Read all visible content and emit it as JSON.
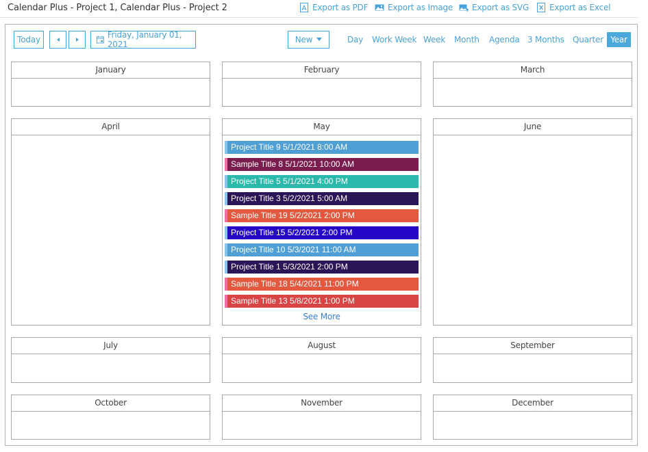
{
  "app": {
    "title": "Calendar Plus - Project 1, Calendar Plus - Project 2"
  },
  "exports": [
    {
      "label": "Export as PDF",
      "icon": "pdf-icon"
    },
    {
      "label": "Export as Image",
      "icon": "image-icon"
    },
    {
      "label": "Export as SVG",
      "icon": "svg-image-icon"
    },
    {
      "label": "Export as Excel",
      "icon": "excel-icon"
    }
  ],
  "toolbar": {
    "today_label": "Today",
    "prev_icon": "prev-icon",
    "next_icon": "next-icon",
    "date_label": "Friday, January 01, 2021",
    "new_label": "New",
    "views": [
      "Day",
      "Work Week",
      "Week",
      "Month",
      "Agenda",
      "3 Months",
      "Quarter",
      "Year"
    ],
    "active_view": "Year"
  },
  "colors": {
    "accent": "#4aa3d8",
    "active_tab_bg": "#4aa8dc",
    "border": "#a8a8a8",
    "see_more": "#3a7fd5",
    "project_accent": "#8cc3ea",
    "sample_accent": "#ee6fa6"
  },
  "months": [
    {
      "name": "January",
      "events": []
    },
    {
      "name": "February",
      "events": []
    },
    {
      "name": "March",
      "events": []
    },
    {
      "name": "April",
      "events": []
    },
    {
      "name": "May",
      "see_more": "See More",
      "events": [
        {
          "label": "Project Title 9 5/1/2021 8:00 AM",
          "color": "#4f9ed4",
          "accent": "#8cc3ea"
        },
        {
          "label": "Sample Title 8 5/1/2021 10:00 AM",
          "color": "#7b1c4e",
          "accent": "#ee6fa6"
        },
        {
          "label": "Project Title 5 5/1/2021 4:00 PM",
          "color": "#2bb9ab",
          "accent": "#8cc3ea"
        },
        {
          "label": "Project Title 3 5/2/2021 5:00 AM",
          "color": "#2a1656",
          "accent": "#8cc3ea"
        },
        {
          "label": "Sample Title 19 5/2/2021 2:00 PM",
          "color": "#e2593f",
          "accent": "#ee6fa6"
        },
        {
          "label": "Project Title 15 5/2/2021 2:00 PM",
          "color": "#2407c6",
          "accent": "#8cc3ea"
        },
        {
          "label": "Project Title 10 5/3/2021 11:00 AM",
          "color": "#4f9ed4",
          "accent": "#8cc3ea"
        },
        {
          "label": "Project Title 1 5/3/2021 2:00 PM",
          "color": "#2a1656",
          "accent": "#8cc3ea"
        },
        {
          "label": "Sample Title 18 5/4/2021 11:00 PM",
          "color": "#e2593f",
          "accent": "#ee6fa6"
        },
        {
          "label": "Sample Title 13 5/8/2021 1:00 PM",
          "color": "#d94545",
          "accent": "#ee6fa6"
        }
      ]
    },
    {
      "name": "June",
      "events": []
    },
    {
      "name": "July",
      "events": []
    },
    {
      "name": "August",
      "events": []
    },
    {
      "name": "September",
      "events": []
    },
    {
      "name": "October",
      "events": []
    },
    {
      "name": "November",
      "events": []
    },
    {
      "name": "December",
      "events": []
    }
  ]
}
